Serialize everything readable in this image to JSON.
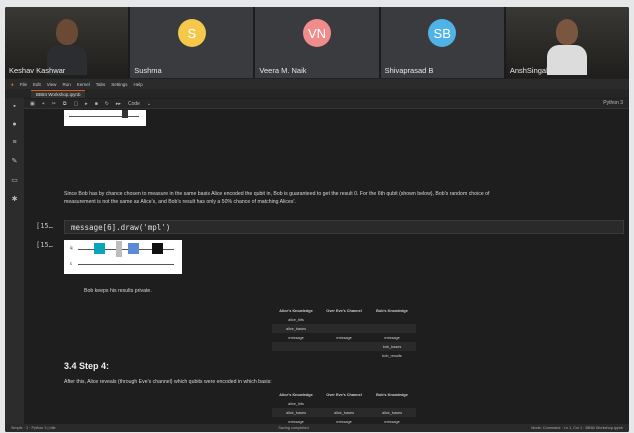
{
  "participants": [
    {
      "name": "Keshav Kashwar",
      "type": "camera"
    },
    {
      "name": "Sushma",
      "initials": "S",
      "color": "#f3c84b",
      "type": "avatar"
    },
    {
      "name": "Veera M. Naik",
      "initials": "VN",
      "color": "#f08c8c",
      "type": "avatar"
    },
    {
      "name": "Shivaprasad B",
      "initials": "SB",
      "color": "#4fb3e8",
      "type": "avatar"
    },
    {
      "name": "AnshSingal",
      "type": "camera"
    }
  ],
  "menu": [
    "File",
    "Edit",
    "View",
    "Run",
    "Kernel",
    "Tabs",
    "Settings",
    "Help"
  ],
  "tab_title": "BB84 Workshop.ipynb",
  "toolbar": [
    "+",
    "✂",
    "⧉",
    "▢",
    "▸",
    "■",
    "↻",
    "▸▸",
    "Code",
    "⌄"
  ],
  "kernel_label": "Python 3",
  "activity_icons": [
    "folder-icon",
    "circle-icon",
    "list-icon",
    "puzzle-icon",
    "tabs-icon",
    "wrench-icon"
  ],
  "notebook": {
    "md1": "Since Bob has by chance chosen to measure in the same basis Alice encoded the qubit in, Bob is guaranteed to get the result 0. For the 6th qubit (shown below), Bob's random choice of",
    "md2": "measurement is not the same as Alice's, and Bob's result has only a 50% chance of matching Alices'.",
    "prompt1": "[15…",
    "code": "message[6].draw('mpl')",
    "prompt2": "[15…",
    "q_label": "q",
    "c_label": "c",
    "md3": "Bob keeps his results private.",
    "table1": {
      "headers": [
        "Alice's Knowledge",
        "Over Eve's Channel",
        "Bob's Knowledge"
      ],
      "rows": [
        [
          "alice_bits",
          "",
          ""
        ],
        [
          "alice_bases",
          "",
          ""
        ],
        [
          "message",
          "message",
          "message"
        ],
        [
          "",
          "",
          "bob_bases"
        ],
        [
          "",
          "",
          "bob_results"
        ]
      ]
    },
    "section": "3.4 Step 4:",
    "md4": "After this, Alice reveals (through Eve's channel) which qubits were encoded in which basis:",
    "table2": {
      "headers": [
        "Alice's Knowledge",
        "Over Eve's Channel",
        "Bob's Knowledge"
      ],
      "rows": [
        [
          "alice_bits",
          "",
          ""
        ],
        [
          "alice_bases",
          "alice_bases",
          "alice_bases"
        ],
        [
          "message",
          "message",
          "message"
        ]
      ]
    }
  },
  "status": {
    "left": "Simple  ·  1  ·  Python 3 | Idle",
    "center": "Saving completed",
    "right": "Mode: Command  ·  Ln 1, Col 1  ·  BB84 Workshop.ipynb"
  }
}
